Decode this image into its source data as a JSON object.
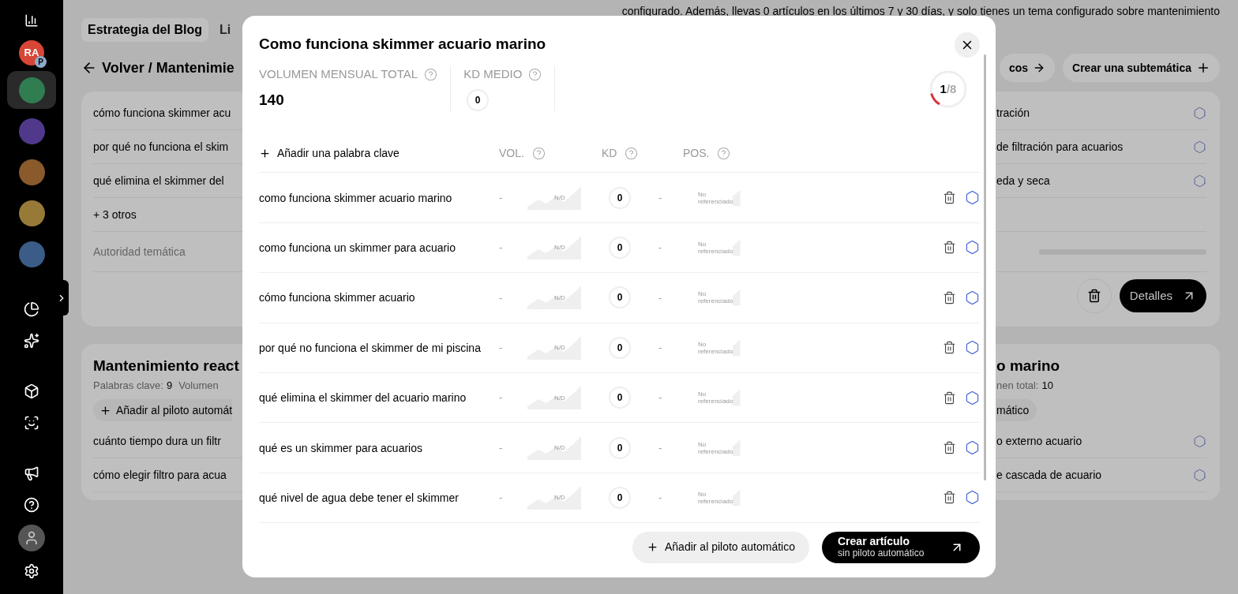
{
  "sidebar": {
    "items": [
      {
        "kind": "stats"
      },
      {
        "kind": "logo",
        "text": "RA",
        "badge": "P"
      },
      {
        "kind": "avatar",
        "selected": true,
        "color": "#2f7d50"
      },
      {
        "kind": "avatar",
        "selected": false,
        "color": "#50388a"
      },
      {
        "kind": "avatar",
        "selected": false,
        "color": "#8a5a2c"
      },
      {
        "kind": "avatar",
        "selected": false,
        "color": "#977a38"
      },
      {
        "kind": "avatar",
        "selected": false,
        "color": "#3b5c87"
      },
      {
        "kind": "gap"
      },
      {
        "kind": "pie"
      },
      {
        "kind": "sparkles"
      },
      {
        "kind": "gap"
      },
      {
        "kind": "box"
      },
      {
        "kind": "scan"
      },
      {
        "kind": "gap"
      },
      {
        "kind": "megaphone"
      },
      {
        "kind": "help"
      },
      {
        "kind": "user"
      },
      {
        "kind": "settings"
      }
    ]
  },
  "page": {
    "notice": "configurado. Además, llevas 0 artículos en los últimos 7 y 30 días, y solo tienes un tema configurado sobre mantenimiento",
    "tabs": [
      {
        "label": "Estrategia del Blog",
        "selected": true
      },
      {
        "label": "Li",
        "selected": false
      }
    ],
    "breadcrumb": "Volver / Mantenimie",
    "actions": [
      {
        "label": "cos",
        "kind": "arrow"
      },
      {
        "label": "Crear una subtemática",
        "kind": "plus"
      }
    ]
  },
  "left_cards": [
    {
      "items": [
        "cómo funciona skimmer acu",
        "por qué no funciona el skim",
        "qué elimina el skimmer del"
      ],
      "more": "+ 3 otros",
      "section": "Autoridad temática"
    },
    {
      "title": "Mantenimiento react",
      "meta": [
        {
          "label": "Palabras clave:",
          "value": "9"
        },
        {
          "label": "Volumen"
        }
      ],
      "button": "Añadir al piloto automát",
      "items": [
        "cuánto tiempo dura un filtr",
        "cómo elegir filtro para acua"
      ]
    }
  ],
  "right_cards": [
    {
      "items": [
        "tración",
        "de filtración para acuarios",
        "eda y seca"
      ],
      "details": "Detalles"
    },
    {
      "title": "o marino",
      "meta": [
        {
          "label": "nen total:",
          "value": "10"
        }
      ],
      "button": "mático",
      "items": [
        "o externo acuario",
        "e cascada de acuario"
      ]
    }
  ],
  "modal": {
    "title": "Como funciona skimmer acuario marino",
    "stats": [
      {
        "label": "VOLUMEN MENSUAL TOTAL",
        "value": "140",
        "kind": "plain"
      },
      {
        "label": "KD MEDIO",
        "value": "0",
        "kind": "ring"
      }
    ],
    "progress": {
      "current": "1",
      "total": "/8",
      "level": 0.125
    },
    "add_keyword": "Añadir una palabra clave",
    "columns": [
      "VOL.",
      "KD",
      "POS."
    ],
    "rows": [
      {
        "keyword": "como funciona skimmer acuario marino",
        "volume": "-",
        "volume_trend": "N/D",
        "kd": "0",
        "position": "-",
        "position_trend": "No referenciado"
      },
      {
        "keyword": "como funciona un skimmer para acuario",
        "volume": "-",
        "volume_trend": "N/D",
        "kd": "0",
        "position": "-",
        "position_trend": "No referenciado"
      },
      {
        "keyword": "cómo funciona skimmer acuario",
        "volume": "-",
        "volume_trend": "N/D",
        "kd": "0",
        "position": "-",
        "position_trend": "No referenciado"
      },
      {
        "keyword": "por qué no funciona el skimmer de mi piscina",
        "volume": "-",
        "volume_trend": "N/D",
        "kd": "0",
        "position": "-",
        "position_trend": "No referenciado"
      },
      {
        "keyword": "qué elimina el skimmer del acuario marino",
        "volume": "-",
        "volume_trend": "N/D",
        "kd": "0",
        "position": "-",
        "position_trend": "No referenciado"
      },
      {
        "keyword": "qué es un skimmer para acuarios",
        "volume": "-",
        "volume_trend": "N/D",
        "kd": "0",
        "position": "-",
        "position_trend": "No referenciado"
      },
      {
        "keyword": "qué nivel de agua debe tener el skimmer",
        "volume": "-",
        "volume_trend": "N/D",
        "kd": "0",
        "position": "-",
        "position_trend": "No referenciado"
      }
    ],
    "autopilot": "Añadir al piloto automático",
    "create": {
      "title": "Crear artículo",
      "subtitle": "sin piloto automático"
    }
  }
}
